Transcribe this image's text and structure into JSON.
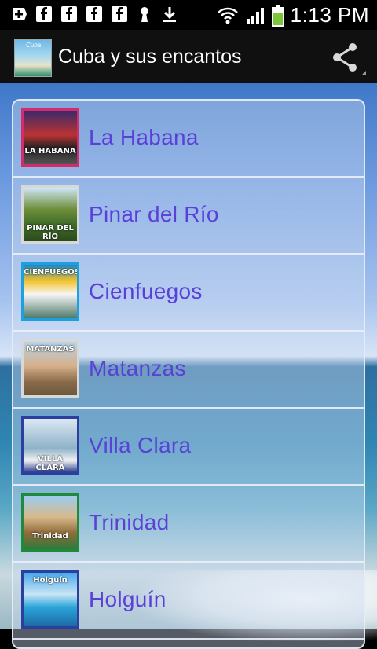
{
  "status_bar": {
    "time": "1:13 PM",
    "icons": [
      "add-icon",
      "fb-icon",
      "fb-icon",
      "fb-icon",
      "fb-icon",
      "keyhole-icon",
      "download-icon",
      "wifi-icon",
      "signal-icon",
      "battery-icon"
    ]
  },
  "action_bar": {
    "title": "Cuba y sus encantos",
    "app_icon_label": "Cuba"
  },
  "colors": {
    "accent_text": "#5a40d8",
    "action_bar_bg": "#101010"
  },
  "cities": [
    {
      "label": "La Habana",
      "thumb_caption": "LA HABANA",
      "border": "#d52a6b"
    },
    {
      "label": "Pinar del Río",
      "thumb_caption": "PINAR DEL RÍO",
      "border": "#d8d8d8"
    },
    {
      "label": "Cienfuegos",
      "thumb_caption": "CIENFUEGOS",
      "border": "#1d9fe0"
    },
    {
      "label": "Matanzas",
      "thumb_caption": "MATANZAS",
      "border": "#d8d8d8"
    },
    {
      "label": "Villa Clara",
      "thumb_caption": "VILLA CLARA",
      "border": "#2a3f9f"
    },
    {
      "label": "Trinidad",
      "thumb_caption": "Trinidad",
      "border": "#1f8a3a"
    },
    {
      "label": "Holguín",
      "thumb_caption": "Holguín",
      "border": "#2a3f9f"
    }
  ]
}
